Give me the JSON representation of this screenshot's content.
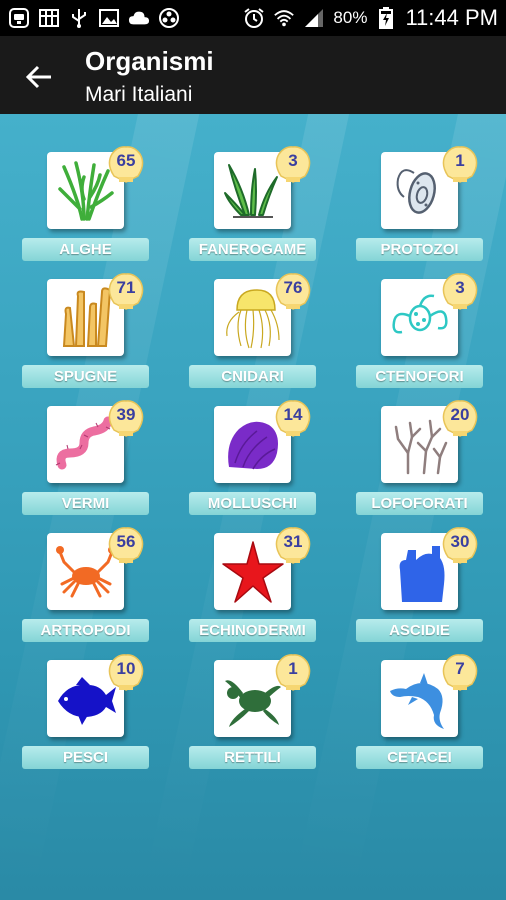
{
  "statusbar": {
    "battery": "80%",
    "time": "11:44 PM"
  },
  "appbar": {
    "title": "Organismi",
    "subtitle": "Mari Italiani"
  },
  "colors": {
    "background": "#3aa3bf",
    "appbar": "#1a1a1a",
    "label": "#9fe0e2",
    "count": "#3a3fa0",
    "shell": "#fce79a"
  },
  "categories": [
    {
      "label": "ALGHE",
      "count": "65",
      "icon": "seaweed-icon"
    },
    {
      "label": "FANEROGAME",
      "count": "3",
      "icon": "seagrass-icon"
    },
    {
      "label": "PROTOZOI",
      "count": "1",
      "icon": "protozoa-icon"
    },
    {
      "label": "SPUGNE",
      "count": "71",
      "icon": "sponge-icon"
    },
    {
      "label": "CNIDARI",
      "count": "76",
      "icon": "jellyfish-icon"
    },
    {
      "label": "CTENOFORI",
      "count": "3",
      "icon": "comb-jelly-icon"
    },
    {
      "label": "VERMI",
      "count": "39",
      "icon": "worm-icon"
    },
    {
      "label": "MOLLUSCHI",
      "count": "14",
      "icon": "seashell-icon"
    },
    {
      "label": "LOFOFORATI",
      "count": "20",
      "icon": "bryozoan-icon"
    },
    {
      "label": "ARTROPODI",
      "count": "56",
      "icon": "crab-icon"
    },
    {
      "label": "ECHINODERMI",
      "count": "31",
      "icon": "starfish-icon"
    },
    {
      "label": "ASCIDIE",
      "count": "30",
      "icon": "tunicate-icon"
    },
    {
      "label": "PESCI",
      "count": "10",
      "icon": "fish-icon"
    },
    {
      "label": "RETTILI",
      "count": "1",
      "icon": "turtle-icon"
    },
    {
      "label": "CETACEI",
      "count": "7",
      "icon": "dolphin-icon"
    }
  ]
}
